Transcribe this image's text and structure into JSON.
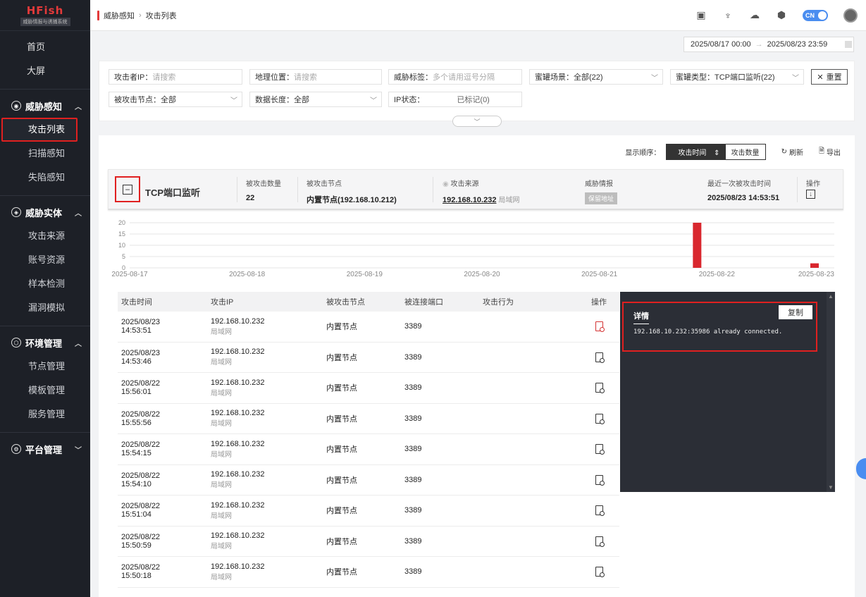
{
  "logo": {
    "title": "HFish",
    "subtitle": "威胁情报与诱捕系统"
  },
  "sidebar": {
    "top_items": [
      "首页",
      "大屏"
    ],
    "groups": [
      {
        "label": "威胁感知",
        "items": [
          "攻击列表",
          "扫描感知",
          "失陷感知"
        ]
      },
      {
        "label": "威胁实体",
        "items": [
          "攻击来源",
          "账号资源",
          "样本检测",
          "漏洞模拟"
        ]
      },
      {
        "label": "环境管理",
        "items": [
          "节点管理",
          "模板管理",
          "服务管理"
        ]
      },
      {
        "label": "平台管理",
        "items": []
      }
    ]
  },
  "breadcrumb": {
    "parent": "威胁感知",
    "current": "攻击列表"
  },
  "topbar": {
    "lang": "CN"
  },
  "daterange": {
    "start": "2025/08/17 00:00",
    "sep": "→",
    "end": "2025/08/23 23:59"
  },
  "filters": {
    "attacker_ip": {
      "label": "攻击者IP：",
      "placeholder": "请搜索"
    },
    "geo": {
      "label": "地理位置：",
      "placeholder": "请搜索"
    },
    "threat_tag": {
      "label": "威胁标签：",
      "placeholder": "多个请用逗号分隔"
    },
    "scene": {
      "label": "蜜罐场景：",
      "value": "全部(22)"
    },
    "honeypot_type": {
      "label": "蜜罐类型：",
      "value": "TCP端口监听(22)"
    },
    "reset": "重置",
    "node": {
      "label": "被攻击节点：",
      "value": "全部"
    },
    "data_len": {
      "label": "数据长度：",
      "value": "全部"
    },
    "ip_status": {
      "label": "IP状态：",
      "value": "已标记(0)"
    }
  },
  "sortbar": {
    "label": "显示顺序：",
    "opt1": "攻击时间",
    "opt2": "攻击数量",
    "refresh": "刷新",
    "export": "导出"
  },
  "group": {
    "title": "TCP端口监听",
    "count_label": "被攻击数量",
    "count": "22",
    "node_label": "被攻击节点",
    "node": "内置节点(192.168.10.212)",
    "source_label": "攻击来源",
    "source_ip": "192.168.10.232",
    "source_scope": "局域网",
    "intel_label": "威胁情报",
    "intel_badge": "保留地址",
    "last_label": "最近一次被攻击时间",
    "last": "2025/08/23 14:53:51",
    "op_label": "操作"
  },
  "chart_data": {
    "type": "bar",
    "categories": [
      "2025-08-17",
      "2025-08-18",
      "2025-08-19",
      "2025-08-20",
      "2025-08-21",
      "2025-08-22",
      "2025-08-23"
    ],
    "values": [
      0,
      0,
      0,
      0,
      0,
      20,
      2
    ],
    "ylim": [
      0,
      20
    ],
    "yticks": [
      "20",
      "15",
      "10",
      "5",
      "0"
    ],
    "color": "#d9272e"
  },
  "table": {
    "headers": [
      "攻击时间",
      "攻击IP",
      "被攻击节点",
      "被连接端口",
      "攻击行为",
      "操作"
    ],
    "rows": [
      {
        "date": "2025/08/23",
        "time": "14:53:51",
        "ip": "192.168.10.232",
        "scope": "局域网",
        "node": "内置节点",
        "port": "3389"
      },
      {
        "date": "2025/08/23",
        "time": "14:53:46",
        "ip": "192.168.10.232",
        "scope": "局域网",
        "node": "内置节点",
        "port": "3389"
      },
      {
        "date": "2025/08/22",
        "time": "15:56:01",
        "ip": "192.168.10.232",
        "scope": "局域网",
        "node": "内置节点",
        "port": "3389"
      },
      {
        "date": "2025/08/22",
        "time": "15:55:56",
        "ip": "192.168.10.232",
        "scope": "局域网",
        "node": "内置节点",
        "port": "3389"
      },
      {
        "date": "2025/08/22",
        "time": "15:54:15",
        "ip": "192.168.10.232",
        "scope": "局域网",
        "node": "内置节点",
        "port": "3389"
      },
      {
        "date": "2025/08/22",
        "time": "15:54:10",
        "ip": "192.168.10.232",
        "scope": "局域网",
        "node": "内置节点",
        "port": "3389"
      },
      {
        "date": "2025/08/22",
        "time": "15:51:04",
        "ip": "192.168.10.232",
        "scope": "局域网",
        "node": "内置节点",
        "port": "3389"
      },
      {
        "date": "2025/08/22",
        "time": "15:50:59",
        "ip": "192.168.10.232",
        "scope": "局域网",
        "node": "内置节点",
        "port": "3389"
      },
      {
        "date": "2025/08/22",
        "time": "15:50:18",
        "ip": "192.168.10.232",
        "scope": "局域网",
        "node": "内置节点",
        "port": "3389"
      }
    ]
  },
  "detail": {
    "title": "详情",
    "copy": "复制",
    "text": "192.168.10.232:35986 already connected."
  }
}
